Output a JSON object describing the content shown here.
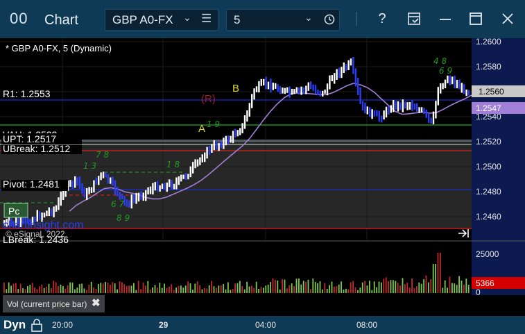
{
  "window": {
    "icon_text": "00",
    "title": "Chart",
    "symbol": "GBP A0-FX",
    "interval": "5",
    "icons": [
      "chevron-down-icon",
      "menu-icon",
      "clock-icon",
      "settings-icon",
      "help-icon",
      "page-save-icon",
      "minimize-icon",
      "maximize-icon",
      "close-icon"
    ]
  },
  "chart": {
    "header": "* GBP A0-FX, 5 (Dynamic)",
    "levels": {
      "r1": "R1: 1.2553",
      "vah": "VAH: 1.2522",
      "upt": "UPT: 1.2517",
      "ubreak": "UBreak: 1.2512",
      "pivot": "Pivot: 1.2481",
      "lbreak": "LBreak: 1.2436"
    },
    "pc_label": "Pc",
    "watermark": "chartinsight.com",
    "copyright": "© eSignal, 2022",
    "letters": {
      "a": "A",
      "b": "B",
      "r": "(R)"
    },
    "price_ticks": [
      "1.2600",
      "1.2580",
      "1.2560",
      "1.2540",
      "1.2520",
      "1.2500",
      "1.2480",
      "1.2460"
    ],
    "last_price": "1.2560",
    "ma_price": "1.2547",
    "vol_ticks": [
      "25000",
      "0"
    ],
    "vol_last": "5366",
    "colors": {
      "bull": "#ffffff",
      "bear": "#2b3df0",
      "ma": "#a27fd6",
      "r1": "#1a2fd0",
      "vol_up": "#7ec850",
      "vol_down": "#c02a2a"
    }
  },
  "info_box": {
    "text": "Vol (current price bar)",
    "close": "✖"
  },
  "bottom": {
    "dyn": "Dyn",
    "times": [
      "20:00",
      "29",
      "04:00",
      "08:00"
    ]
  }
}
